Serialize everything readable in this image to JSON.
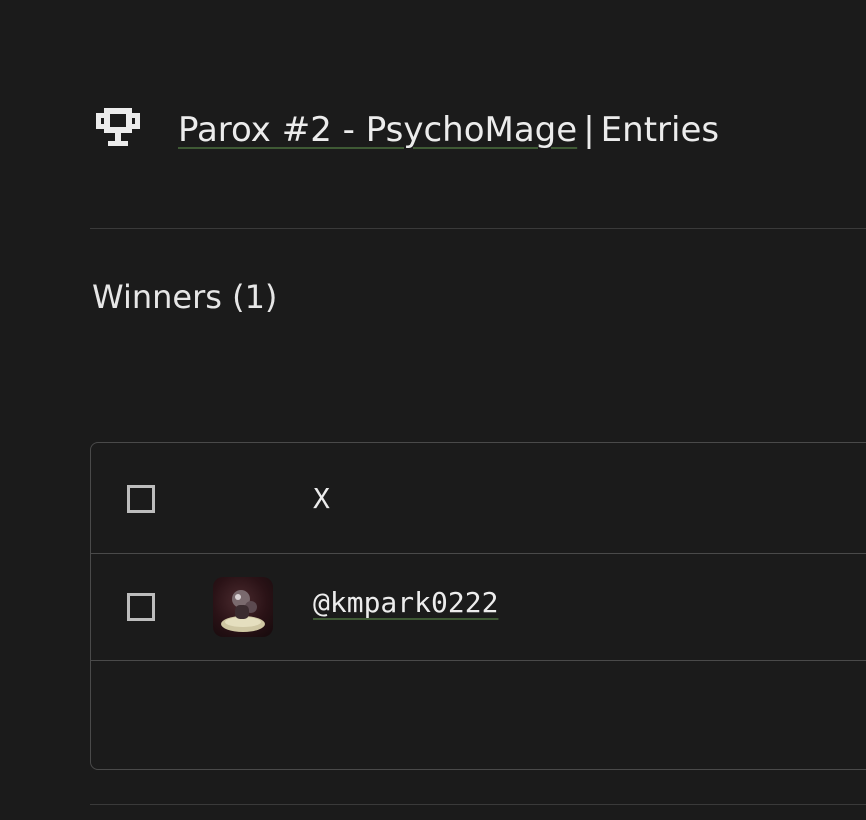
{
  "header": {
    "icon": "trophy-icon",
    "title_link": "Parox #2 - PsychoMage",
    "separator": "|",
    "title_suffix": "Entries"
  },
  "section": {
    "title": "Winners (1)"
  },
  "table": {
    "column_header": "X",
    "rows": [
      {
        "avatar": "user-avatar",
        "handle": "@kmpark0222"
      }
    ]
  },
  "colors": {
    "background": "#1b1b1b",
    "text": "#ececec",
    "link_underline": "#3f5a35",
    "border": "#4a4a4a"
  }
}
